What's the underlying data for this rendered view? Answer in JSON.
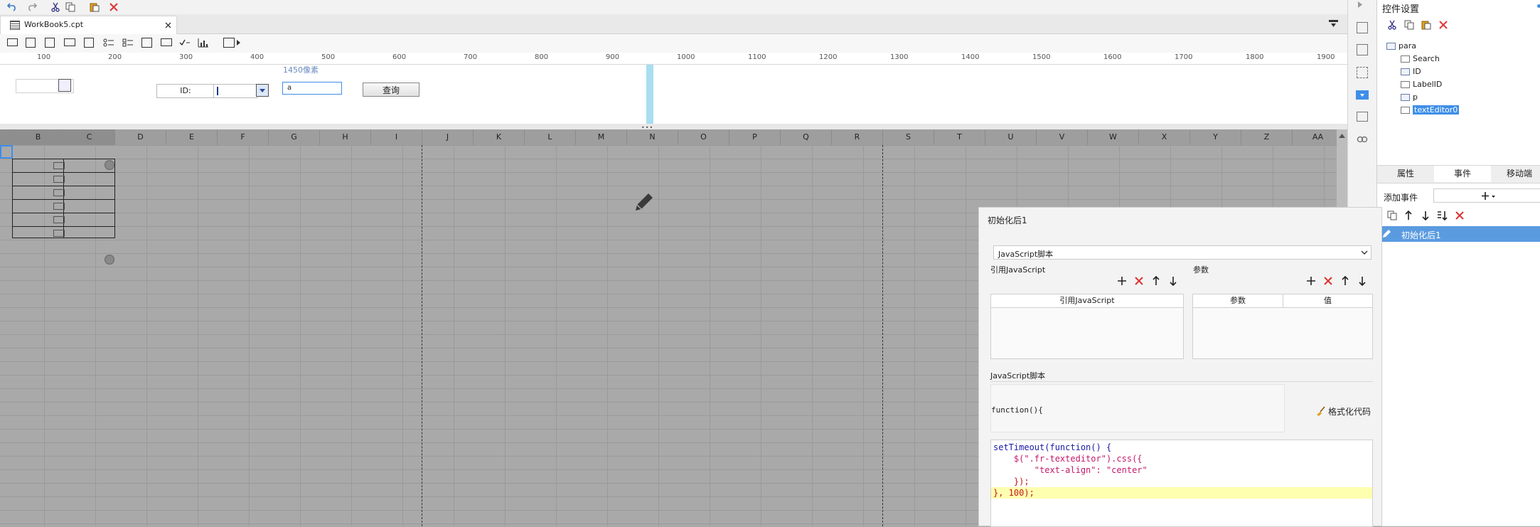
{
  "file_tab": {
    "name": "WorkBook5.cpt"
  },
  "ruler": {
    "labels": [
      "100",
      "200",
      "300",
      "400",
      "500",
      "600",
      "700",
      "800",
      "900",
      "1000",
      "1100",
      "1200",
      "1300",
      "1400",
      "1500",
      "1600",
      "1700",
      "1800",
      "1900"
    ]
  },
  "params": {
    "id_label": "ID:",
    "text_editor_value": "a",
    "size_tooltip": "1450像素",
    "query_button": "查询"
  },
  "grid": {
    "columns": [
      "B",
      "C",
      "D",
      "E",
      "F",
      "G",
      "H",
      "I",
      "J",
      "K",
      "L",
      "M",
      "N",
      "O",
      "P",
      "Q",
      "R",
      "S",
      "T",
      "U",
      "V",
      "W",
      "X",
      "Y",
      "Z",
      "AA"
    ]
  },
  "right_panel": {
    "title": "控件设置",
    "tree": [
      {
        "label": "para",
        "selected": false
      },
      {
        "label": "Search",
        "selected": false
      },
      {
        "label": "ID",
        "selected": false
      },
      {
        "label": "LabelID",
        "selected": false
      },
      {
        "label": "p",
        "selected": false
      },
      {
        "label": "textEditor0",
        "selected": true
      }
    ],
    "tabs": [
      "属性",
      "事件",
      "移动端"
    ],
    "add_event_label": "添加事件",
    "event_item": "初始化后1"
  },
  "event_dialog": {
    "title": "初始化后1",
    "script_type": "JavaScript脚本",
    "ref_js_label": "引用JavaScript",
    "params_label": "参数",
    "ref_js_col": "引用JavaScript",
    "param_col": "参数",
    "value_col": "值",
    "script_label": "JavaScript脚本",
    "function_header": "function(){",
    "format_button": "格式化代码",
    "code_lines": [
      "setTimeout(function() {",
      "    $(\".fr-texteditor\").css({",
      "        \"text-align\": \"center\"",
      "    });",
      "}, 100);"
    ]
  },
  "colors": {
    "accent": "#3e8ee8",
    "selection": "#5a9be0",
    "highlight_line": "#ffffb0",
    "delete_red": "#d33"
  }
}
